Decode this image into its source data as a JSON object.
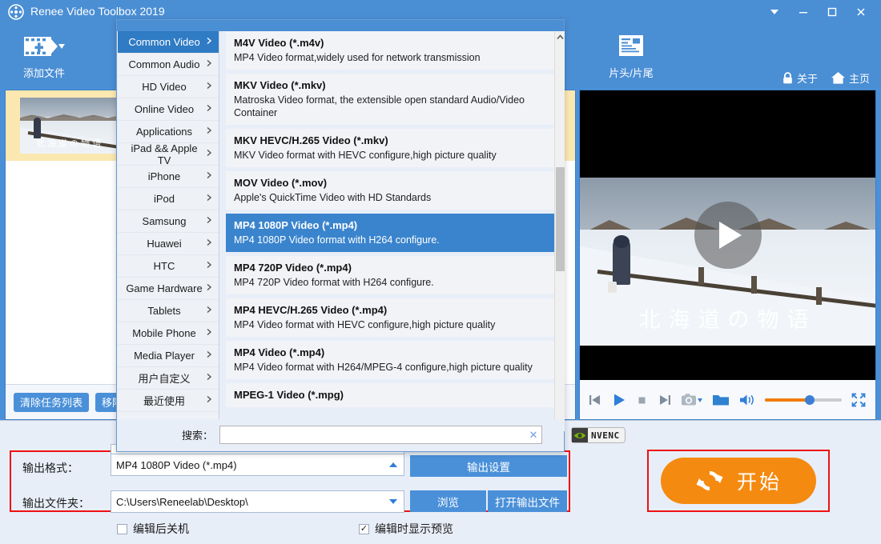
{
  "window": {
    "title": "Renee Video Toolbox 2019",
    "logo_icon": "film-reel-icon",
    "controls": [
      {
        "name": "menu-dropdown-button",
        "icon": "chevron-down-icon"
      },
      {
        "name": "minimize-button",
        "icon": "minimize-icon"
      },
      {
        "name": "maximize-button",
        "icon": "maximize-icon"
      },
      {
        "name": "close-button",
        "icon": "close-icon"
      }
    ]
  },
  "toolbar": {
    "add_file": {
      "label": "添加文件",
      "icon": "add-film-icon"
    },
    "intro_outro": {
      "label": "片头/片尾",
      "icon": "slate-card-icon"
    },
    "about": {
      "label": "关于",
      "icon": "lock-icon"
    },
    "home": {
      "label": "主页",
      "icon": "home-icon"
    }
  },
  "file_list": {
    "rows": [
      {
        "caption": "北海道の物语"
      }
    ],
    "buttons": [
      {
        "label": "清除任务列表"
      },
      {
        "label": "移除"
      }
    ]
  },
  "preview": {
    "caption": "北海道の物语",
    "play_overlay_icon": "play-icon",
    "controls": [
      {
        "name": "previous-button",
        "icon": "skip-previous-icon"
      },
      {
        "name": "play-button",
        "icon": "play-icon"
      },
      {
        "name": "stop-button",
        "icon": "stop-icon"
      },
      {
        "name": "next-button",
        "icon": "skip-next-icon"
      },
      {
        "name": "snapshot-button",
        "icon": "camera-icon"
      },
      {
        "name": "open-folder-button",
        "icon": "folder-icon"
      },
      {
        "name": "volume-button",
        "icon": "speaker-icon"
      },
      {
        "name": "fullscreen-button",
        "icon": "fullscreen-icon"
      }
    ],
    "volume_percent": 55
  },
  "nvenc": {
    "label": "NVENC",
    "icon": "nvidia-eye-icon"
  },
  "output": {
    "format_label": "输出格式：",
    "format_value": "MP4 1080P Video (*.mp4)",
    "format_arrow_icon": "chevron-up-icon",
    "folder_label": "输出文件夹：",
    "folder_value": "C:\\Users\\Reneelab\\Desktop\\",
    "folder_arrow_icon": "chevron-down-icon",
    "output_settings_button": "输出设置",
    "browse_button": "浏览",
    "open_output_button": "打开输出文件",
    "shutdown_after_checkbox": {
      "label": "编辑后关机",
      "checked": false
    },
    "preview_while_editing_checkbox": {
      "label": "编辑时显示预览",
      "checked": true
    }
  },
  "start_button": {
    "label": "开始",
    "icon": "refresh-circular-icon",
    "color": "#f58a10"
  },
  "highlight_color": "#ee1111",
  "accent_color": "#4a90d9",
  "format_popup": {
    "categories": [
      {
        "label": "Common Video",
        "selected": true
      },
      {
        "label": "Common Audio",
        "selected": false
      },
      {
        "label": "HD Video",
        "selected": false
      },
      {
        "label": "Online Video",
        "selected": false
      },
      {
        "label": "Applications",
        "selected": false
      },
      {
        "label": "iPad && Apple TV",
        "selected": false
      },
      {
        "label": "iPhone",
        "selected": false
      },
      {
        "label": "iPod",
        "selected": false
      },
      {
        "label": "Samsung",
        "selected": false
      },
      {
        "label": "Huawei",
        "selected": false
      },
      {
        "label": "HTC",
        "selected": false
      },
      {
        "label": "Game Hardware",
        "selected": false
      },
      {
        "label": "Tablets",
        "selected": false
      },
      {
        "label": "Mobile Phone",
        "selected": false
      },
      {
        "label": "Media Player",
        "selected": false
      },
      {
        "label": "用户自定义",
        "selected": false
      },
      {
        "label": "最近使用",
        "selected": false
      }
    ],
    "chevron_icon": "chevron-right-icon",
    "formats": [
      {
        "title": "M4V Video (*.m4v)",
        "desc": "MP4 Video format,widely used for network transmission",
        "selected": false
      },
      {
        "title": "MKV Video (*.mkv)",
        "desc": "Matroska Video format, the extensible open standard Audio/Video Container",
        "selected": false
      },
      {
        "title": "MKV HEVC/H.265 Video (*.mkv)",
        "desc": "MKV Video format with HEVC configure,high picture quality",
        "selected": false
      },
      {
        "title": "MOV Video (*.mov)",
        "desc": "Apple's QuickTime Video with HD Standards",
        "selected": false
      },
      {
        "title": "MP4 1080P Video (*.mp4)",
        "desc": "MP4 1080P Video format with H264 configure.",
        "selected": true
      },
      {
        "title": "MP4 720P Video (*.mp4)",
        "desc": "MP4 720P Video format with H264 configure.",
        "selected": false
      },
      {
        "title": "MP4 HEVC/H.265 Video (*.mp4)",
        "desc": "MP4 Video format with HEVC configure,high picture quality",
        "selected": false
      },
      {
        "title": "MP4 Video (*.mp4)",
        "desc": "MP4 Video format with H264/MPEG-4 configure,high picture quality",
        "selected": false
      },
      {
        "title": "MPEG-1 Video (*.mpg)",
        "desc": "",
        "selected": false
      }
    ],
    "search_label": "搜索：",
    "search_value": "",
    "search_placeholder": "",
    "search_clear_icon": "close-icon",
    "scroll_up_icon": "chevron-up-icon",
    "scroll_down_icon": "chevron-down-icon"
  }
}
